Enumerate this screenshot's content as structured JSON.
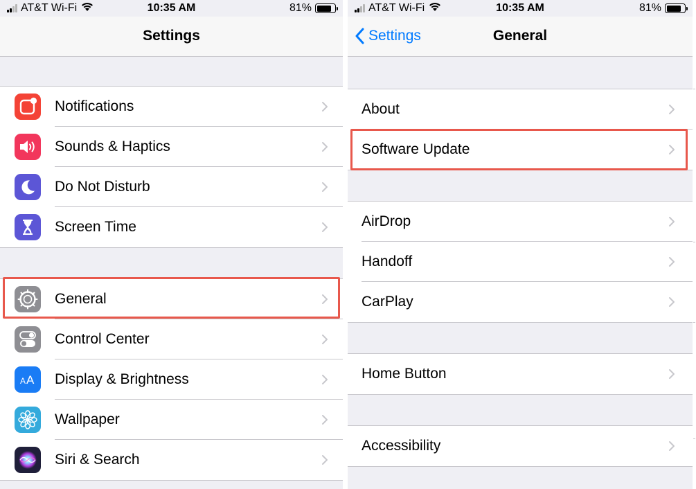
{
  "status_bar": {
    "carrier": "AT&T Wi-Fi",
    "time": "10:35 AM",
    "battery": "81%",
    "battery_level": 0.81
  },
  "left": {
    "nav_title": "Settings",
    "groups": [
      {
        "rows": [
          {
            "label": "Notifications",
            "icon": "notifications-icon",
            "color": "#f44336"
          },
          {
            "label": "Sounds & Haptics",
            "icon": "speaker-icon",
            "color": "#f2365c"
          },
          {
            "label": "Do Not Disturb",
            "icon": "moon-icon",
            "color": "#5c56d6"
          },
          {
            "label": "Screen Time",
            "icon": "hourglass-icon",
            "color": "#5c56d6"
          }
        ]
      },
      {
        "rows": [
          {
            "label": "General",
            "icon": "gear-icon",
            "color": "#8e8e93",
            "highlighted": true
          },
          {
            "label": "Control Center",
            "icon": "toggles-icon",
            "color": "#8e8e93"
          },
          {
            "label": "Display & Brightness",
            "icon": "text-size-icon",
            "color": "#1a7cf5"
          },
          {
            "label": "Wallpaper",
            "icon": "flower-icon",
            "color": "#34aadc"
          },
          {
            "label": "Siri & Search",
            "icon": "siri-icon",
            "color": "#1f1f3a"
          }
        ]
      }
    ]
  },
  "right": {
    "nav_back": "Settings",
    "nav_title": "General",
    "groups": [
      {
        "rows": [
          {
            "label": "About"
          },
          {
            "label": "Software Update",
            "highlighted": true
          }
        ]
      },
      {
        "rows": [
          {
            "label": "AirDrop"
          },
          {
            "label": "Handoff"
          },
          {
            "label": "CarPlay"
          }
        ]
      },
      {
        "rows": [
          {
            "label": "Home Button"
          }
        ]
      },
      {
        "rows": [
          {
            "label": "Accessibility"
          }
        ]
      }
    ]
  },
  "colors": {
    "accent": "#007aff",
    "highlight_border": "#e8584c",
    "background": "#efeff4",
    "separator": "#c8c7cc",
    "chevron": "#c7c7cc"
  }
}
